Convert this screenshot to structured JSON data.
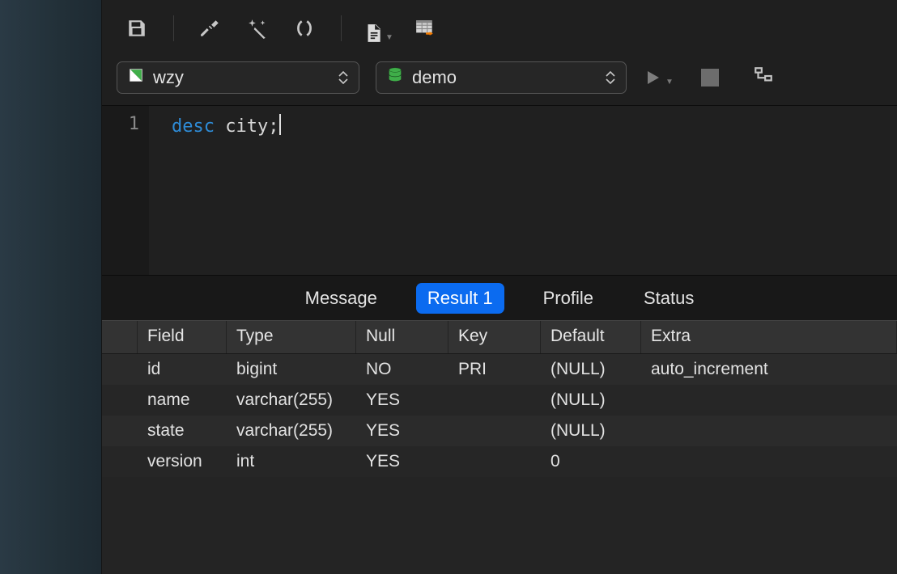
{
  "toolbar": {
    "connection": "wzy",
    "database": "demo"
  },
  "editor": {
    "line_number": "1",
    "keyword": "desc",
    "rest": " city;"
  },
  "result_tabs": {
    "items": [
      {
        "label": "Message",
        "active": false
      },
      {
        "label": "Result 1",
        "active": true
      },
      {
        "label": "Profile",
        "active": false
      },
      {
        "label": "Status",
        "active": false
      }
    ]
  },
  "grid": {
    "headers": [
      "Field",
      "Type",
      "Null",
      "Key",
      "Default",
      "Extra"
    ],
    "rows": [
      {
        "field": "id",
        "type": "bigint",
        "null": "NO",
        "key": "PRI",
        "default": "(NULL)",
        "extra": "auto_increment"
      },
      {
        "field": "name",
        "type": "varchar(255)",
        "null": "YES",
        "key": "",
        "default": "(NULL)",
        "extra": ""
      },
      {
        "field": "state",
        "type": "varchar(255)",
        "null": "YES",
        "key": "",
        "default": "(NULL)",
        "extra": ""
      },
      {
        "field": "version",
        "type": "int",
        "null": "YES",
        "key": "",
        "default": "0",
        "extra": ""
      }
    ]
  }
}
